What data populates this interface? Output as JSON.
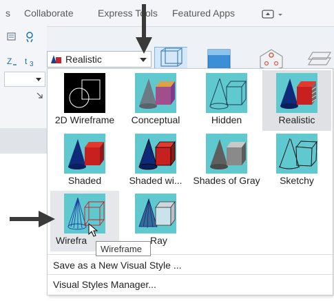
{
  "ribbon": {
    "tabs": [
      "s",
      "Collaborate",
      "Express Tools",
      "Featured Apps"
    ],
    "visual_style_combo": {
      "value": "Realistic"
    }
  },
  "gallery": {
    "items": [
      {
        "label": "2D Wireframe",
        "state": "normal"
      },
      {
        "label": "Conceptual",
        "state": "normal"
      },
      {
        "label": "Hidden",
        "state": "normal"
      },
      {
        "label": "Realistic",
        "state": "selected"
      },
      {
        "label": "Shaded",
        "state": "normal"
      },
      {
        "label": "Shaded wi...",
        "state": "normal"
      },
      {
        "label": "Shades of Gray",
        "state": "normal"
      },
      {
        "label": "Sketchy",
        "state": "normal"
      },
      {
        "label": "Wirefra",
        "state": "hovered"
      },
      {
        "label": "Ray",
        "state": "normal"
      }
    ]
  },
  "tooltip": {
    "text": "Wireframe"
  },
  "menu": {
    "save_as": "Save as a New Visual Style ...",
    "manager": "Visual Styles Manager..."
  },
  "colors": {
    "thumb_bg": "#5fc9cf",
    "accent_red": "#d8231f",
    "accent_blue": "#0a2c8a"
  }
}
